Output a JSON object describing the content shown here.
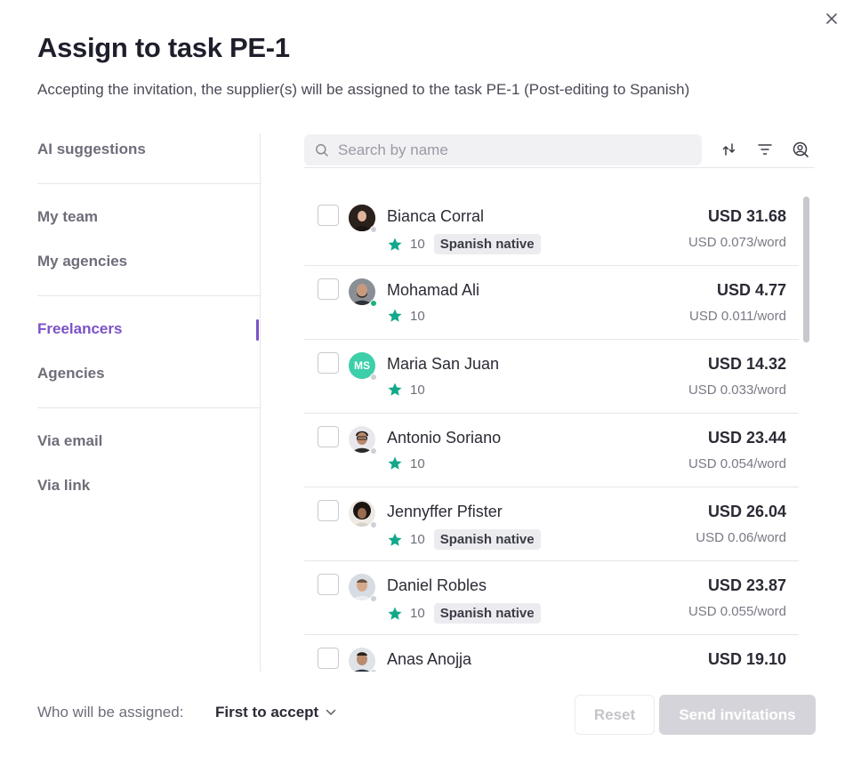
{
  "dialog": {
    "title": "Assign to task PE-1",
    "subtitle": "Accepting the invitation, the supplier(s) will be assigned to the task PE-1 (Post-editing to Spanish)"
  },
  "sidebar": {
    "items": [
      {
        "label": "AI suggestions",
        "active": false
      },
      {
        "label": "My team",
        "active": false
      },
      {
        "label": "My agencies",
        "active": false
      },
      {
        "label": "Freelancers",
        "active": true
      },
      {
        "label": "Agencies",
        "active": false
      },
      {
        "label": "Via email",
        "active": false
      },
      {
        "label": "Via link",
        "active": false
      }
    ],
    "active_color": "#7b52c7"
  },
  "search": {
    "placeholder": "Search by name",
    "value": ""
  },
  "toolbar": {
    "icons": [
      "sort-icon",
      "filter-icon",
      "profile-search-icon"
    ]
  },
  "suppliers": [
    {
      "name": "Bianca Corral",
      "rating": "10",
      "badge": "Spanish native",
      "price": "USD 31.68",
      "rate": "USD 0.073/word",
      "online": false,
      "initials": ""
    },
    {
      "name": "Mohamad Ali",
      "rating": "10",
      "badge": "",
      "price": "USD 4.77",
      "rate": "USD 0.011/word",
      "online": true,
      "initials": ""
    },
    {
      "name": "Maria San Juan",
      "rating": "10",
      "badge": "",
      "price": "USD 14.32",
      "rate": "USD 0.033/word",
      "online": false,
      "initials": "MS"
    },
    {
      "name": "Antonio Soriano",
      "rating": "10",
      "badge": "",
      "price": "USD 23.44",
      "rate": "USD 0.054/word",
      "online": false,
      "initials": ""
    },
    {
      "name": "Jennyffer Pfister",
      "rating": "10",
      "badge": "Spanish native",
      "price": "USD 26.04",
      "rate": "USD 0.06/word",
      "online": false,
      "initials": ""
    },
    {
      "name": "Daniel Robles",
      "rating": "10",
      "badge": "Spanish native",
      "price": "USD 23.87",
      "rate": "USD 0.055/word",
      "online": false,
      "initials": ""
    },
    {
      "name": "Anas Anojja",
      "rating": "",
      "badge": "",
      "price": "USD 19.10",
      "rate": "",
      "online": false,
      "initials": ""
    }
  ],
  "footer": {
    "assign_label": "Who will be assigned:",
    "assign_value": "First to accept",
    "reset_label": "Reset",
    "send_label": "Send invitations"
  },
  "colors": {
    "star": "#12a88a",
    "accent": "#7b52c7",
    "disabled_button": "#d4d4da",
    "initials_avatar": "#3ccfa9"
  }
}
